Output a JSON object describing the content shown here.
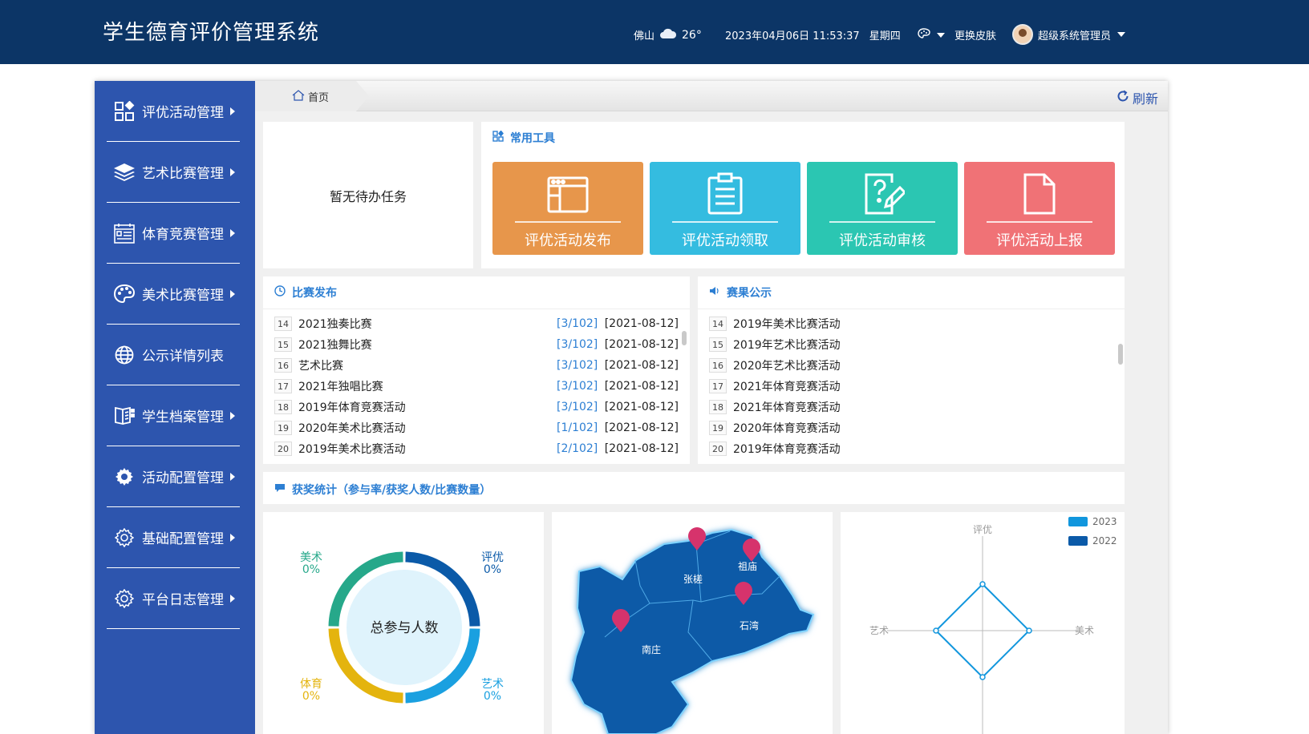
{
  "header": {
    "title": "学生德育评价管理系统",
    "city": "佛山",
    "temperature": "26°",
    "datetime": "2023年04月06日 11:53:37",
    "weekday": "星期四",
    "skin_label": "更换皮肤",
    "user_name": "超级系统管理员",
    "colors": {
      "bg": "#0c3566"
    }
  },
  "sidebar": {
    "items": [
      {
        "label": "评优活动管理",
        "icon": "grid-icon",
        "has_arrow": true
      },
      {
        "label": "艺术比赛管理",
        "icon": "layers-icon",
        "has_arrow": true
      },
      {
        "label": "体育竞赛管理",
        "icon": "calendar-list-icon",
        "has_arrow": true
      },
      {
        "label": "美术比赛管理",
        "icon": "palette-icon",
        "has_arrow": true
      },
      {
        "label": "公示详情列表",
        "icon": "globe-icon",
        "has_arrow": false
      },
      {
        "label": "学生档案管理",
        "icon": "book-icon",
        "has_arrow": true
      },
      {
        "label": "活动配置管理",
        "icon": "gear-icon",
        "has_arrow": true
      },
      {
        "label": "基础配置管理",
        "icon": "gear-outline-icon",
        "has_arrow": true
      },
      {
        "label": "平台日志管理",
        "icon": "gear-outline-icon",
        "has_arrow": true
      }
    ],
    "colors": {
      "bg": "#2d55ae"
    }
  },
  "breadcrumb": {
    "home": "首页",
    "refresh": "刷新"
  },
  "todo": {
    "empty_text": "暂无待办任务"
  },
  "tools": {
    "title": "常用工具",
    "buttons": [
      {
        "label": "评优活动发布",
        "color": "#e7964b",
        "icon": "window-icon"
      },
      {
        "label": "评优活动领取",
        "color": "#34bce0",
        "icon": "clipboard-icon"
      },
      {
        "label": "评优活动审核",
        "color": "#2bc6b2",
        "icon": "question-edit-icon"
      },
      {
        "label": "评优活动上报",
        "color": "#f07276",
        "icon": "file-icon"
      }
    ]
  },
  "competitions": {
    "title": "比赛发布",
    "rows": [
      {
        "num": "14",
        "name": "2021独奏比赛",
        "ratio": "[3/102]",
        "date": "[2021-08-12]"
      },
      {
        "num": "15",
        "name": "2021独舞比赛",
        "ratio": "[3/102]",
        "date": "[2021-08-12]"
      },
      {
        "num": "16",
        "name": "艺术比赛",
        "ratio": "[3/102]",
        "date": "[2021-08-12]"
      },
      {
        "num": "17",
        "name": "2021年独唱比赛",
        "ratio": "[3/102]",
        "date": "[2021-08-12]"
      },
      {
        "num": "18",
        "name": "2019年体育竞赛活动",
        "ratio": "[3/102]",
        "date": "[2021-08-12]"
      },
      {
        "num": "19",
        "name": "2020年美术比赛活动",
        "ratio": "[1/102]",
        "date": "[2021-08-12]"
      },
      {
        "num": "20",
        "name": "2019年美术比赛活动",
        "ratio": "[2/102]",
        "date": "[2021-08-12]"
      }
    ]
  },
  "results": {
    "title": "赛果公示",
    "rows": [
      {
        "num": "14",
        "name": "2019年美术比赛活动"
      },
      {
        "num": "15",
        "name": "2019年艺术比赛活动"
      },
      {
        "num": "16",
        "name": "2020年艺术比赛活动"
      },
      {
        "num": "17",
        "name": "2021年体育竞赛活动"
      },
      {
        "num": "18",
        "name": "2021年体育竞赛活动"
      },
      {
        "num": "19",
        "name": "2020年体育竞赛活动"
      },
      {
        "num": "20",
        "name": "2019年体育竞赛活动"
      }
    ]
  },
  "stats": {
    "title": "获奖统计（参与率/获奖人数/比赛数量）"
  },
  "donut": {
    "center_label": "总参与人数",
    "segments": [
      {
        "name": "评优",
        "value": "0%",
        "color": "#0b5aa8"
      },
      {
        "name": "艺术",
        "value": "0%",
        "color": "#1aa0e0"
      },
      {
        "name": "体育",
        "value": "0%",
        "color": "#e4b40e"
      },
      {
        "name": "美术",
        "value": "0%",
        "color": "#26a88a"
      }
    ]
  },
  "map": {
    "regions": [
      "张槎",
      "祖庙",
      "石湾",
      "南庄"
    ],
    "colors": {
      "fill": "#0d5aa7",
      "glow": "#5cc8ff",
      "pin": "#d6336c"
    }
  },
  "radar": {
    "axes": [
      "评优",
      "美术",
      "艺术"
    ],
    "legend": [
      {
        "name": "2023",
        "color": "#1196dd"
      },
      {
        "name": "2022",
        "color": "#0b5aa8"
      }
    ]
  },
  "chart_data": {
    "type": "pie",
    "categories": [
      "评优",
      "艺术",
      "体育",
      "美术"
    ],
    "values": [
      0,
      0,
      0,
      0
    ]
  }
}
